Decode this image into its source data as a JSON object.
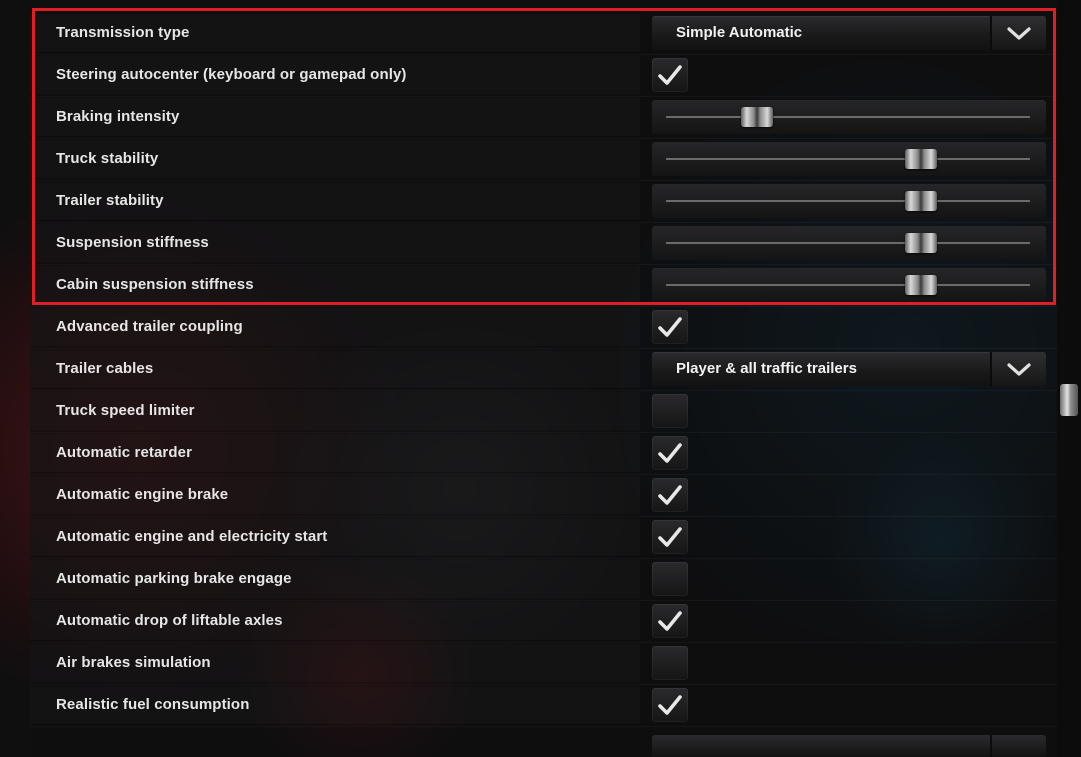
{
  "rows": [
    {
      "label": "Transmission type",
      "control": "dropdown",
      "value": "Simple Automatic"
    },
    {
      "label": "Steering autocenter (keyboard or gamepad only)",
      "control": "checkbox",
      "checked": true
    },
    {
      "label": "Braking intensity",
      "control": "slider",
      "level": 0.25
    },
    {
      "label": "Truck stability",
      "control": "slider",
      "level": 0.7
    },
    {
      "label": "Trailer stability",
      "control": "slider",
      "level": 0.7
    },
    {
      "label": "Suspension stiffness",
      "control": "slider",
      "level": 0.7
    },
    {
      "label": "Cabin suspension stiffness",
      "control": "slider",
      "level": 0.7
    },
    {
      "label": "Advanced trailer coupling",
      "control": "checkbox",
      "checked": true
    },
    {
      "label": "Trailer cables",
      "control": "dropdown",
      "value": "Player & all traffic trailers"
    },
    {
      "label": "Truck speed limiter",
      "control": "checkbox",
      "checked": false
    },
    {
      "label": "Automatic retarder",
      "control": "checkbox",
      "checked": true
    },
    {
      "label": "Automatic engine brake",
      "control": "checkbox",
      "checked": true
    },
    {
      "label": "Automatic engine and electricity start",
      "control": "checkbox",
      "checked": true
    },
    {
      "label": "Automatic parking brake engage",
      "control": "checkbox",
      "checked": false
    },
    {
      "label": "Automatic drop of liftable axles",
      "control": "checkbox",
      "checked": true
    },
    {
      "label": "Air brakes simulation",
      "control": "checkbox",
      "checked": false
    },
    {
      "label": "Realistic fuel consumption",
      "control": "checkbox",
      "checked": true
    }
  ],
  "scrollbar": {
    "position": 0.53
  },
  "icons": {
    "dropdown": "chevron-down-icon",
    "checkbox": "checkmark-icon"
  },
  "colors": {
    "highlight": "#e11d25",
    "text": "#e6e6e6"
  }
}
